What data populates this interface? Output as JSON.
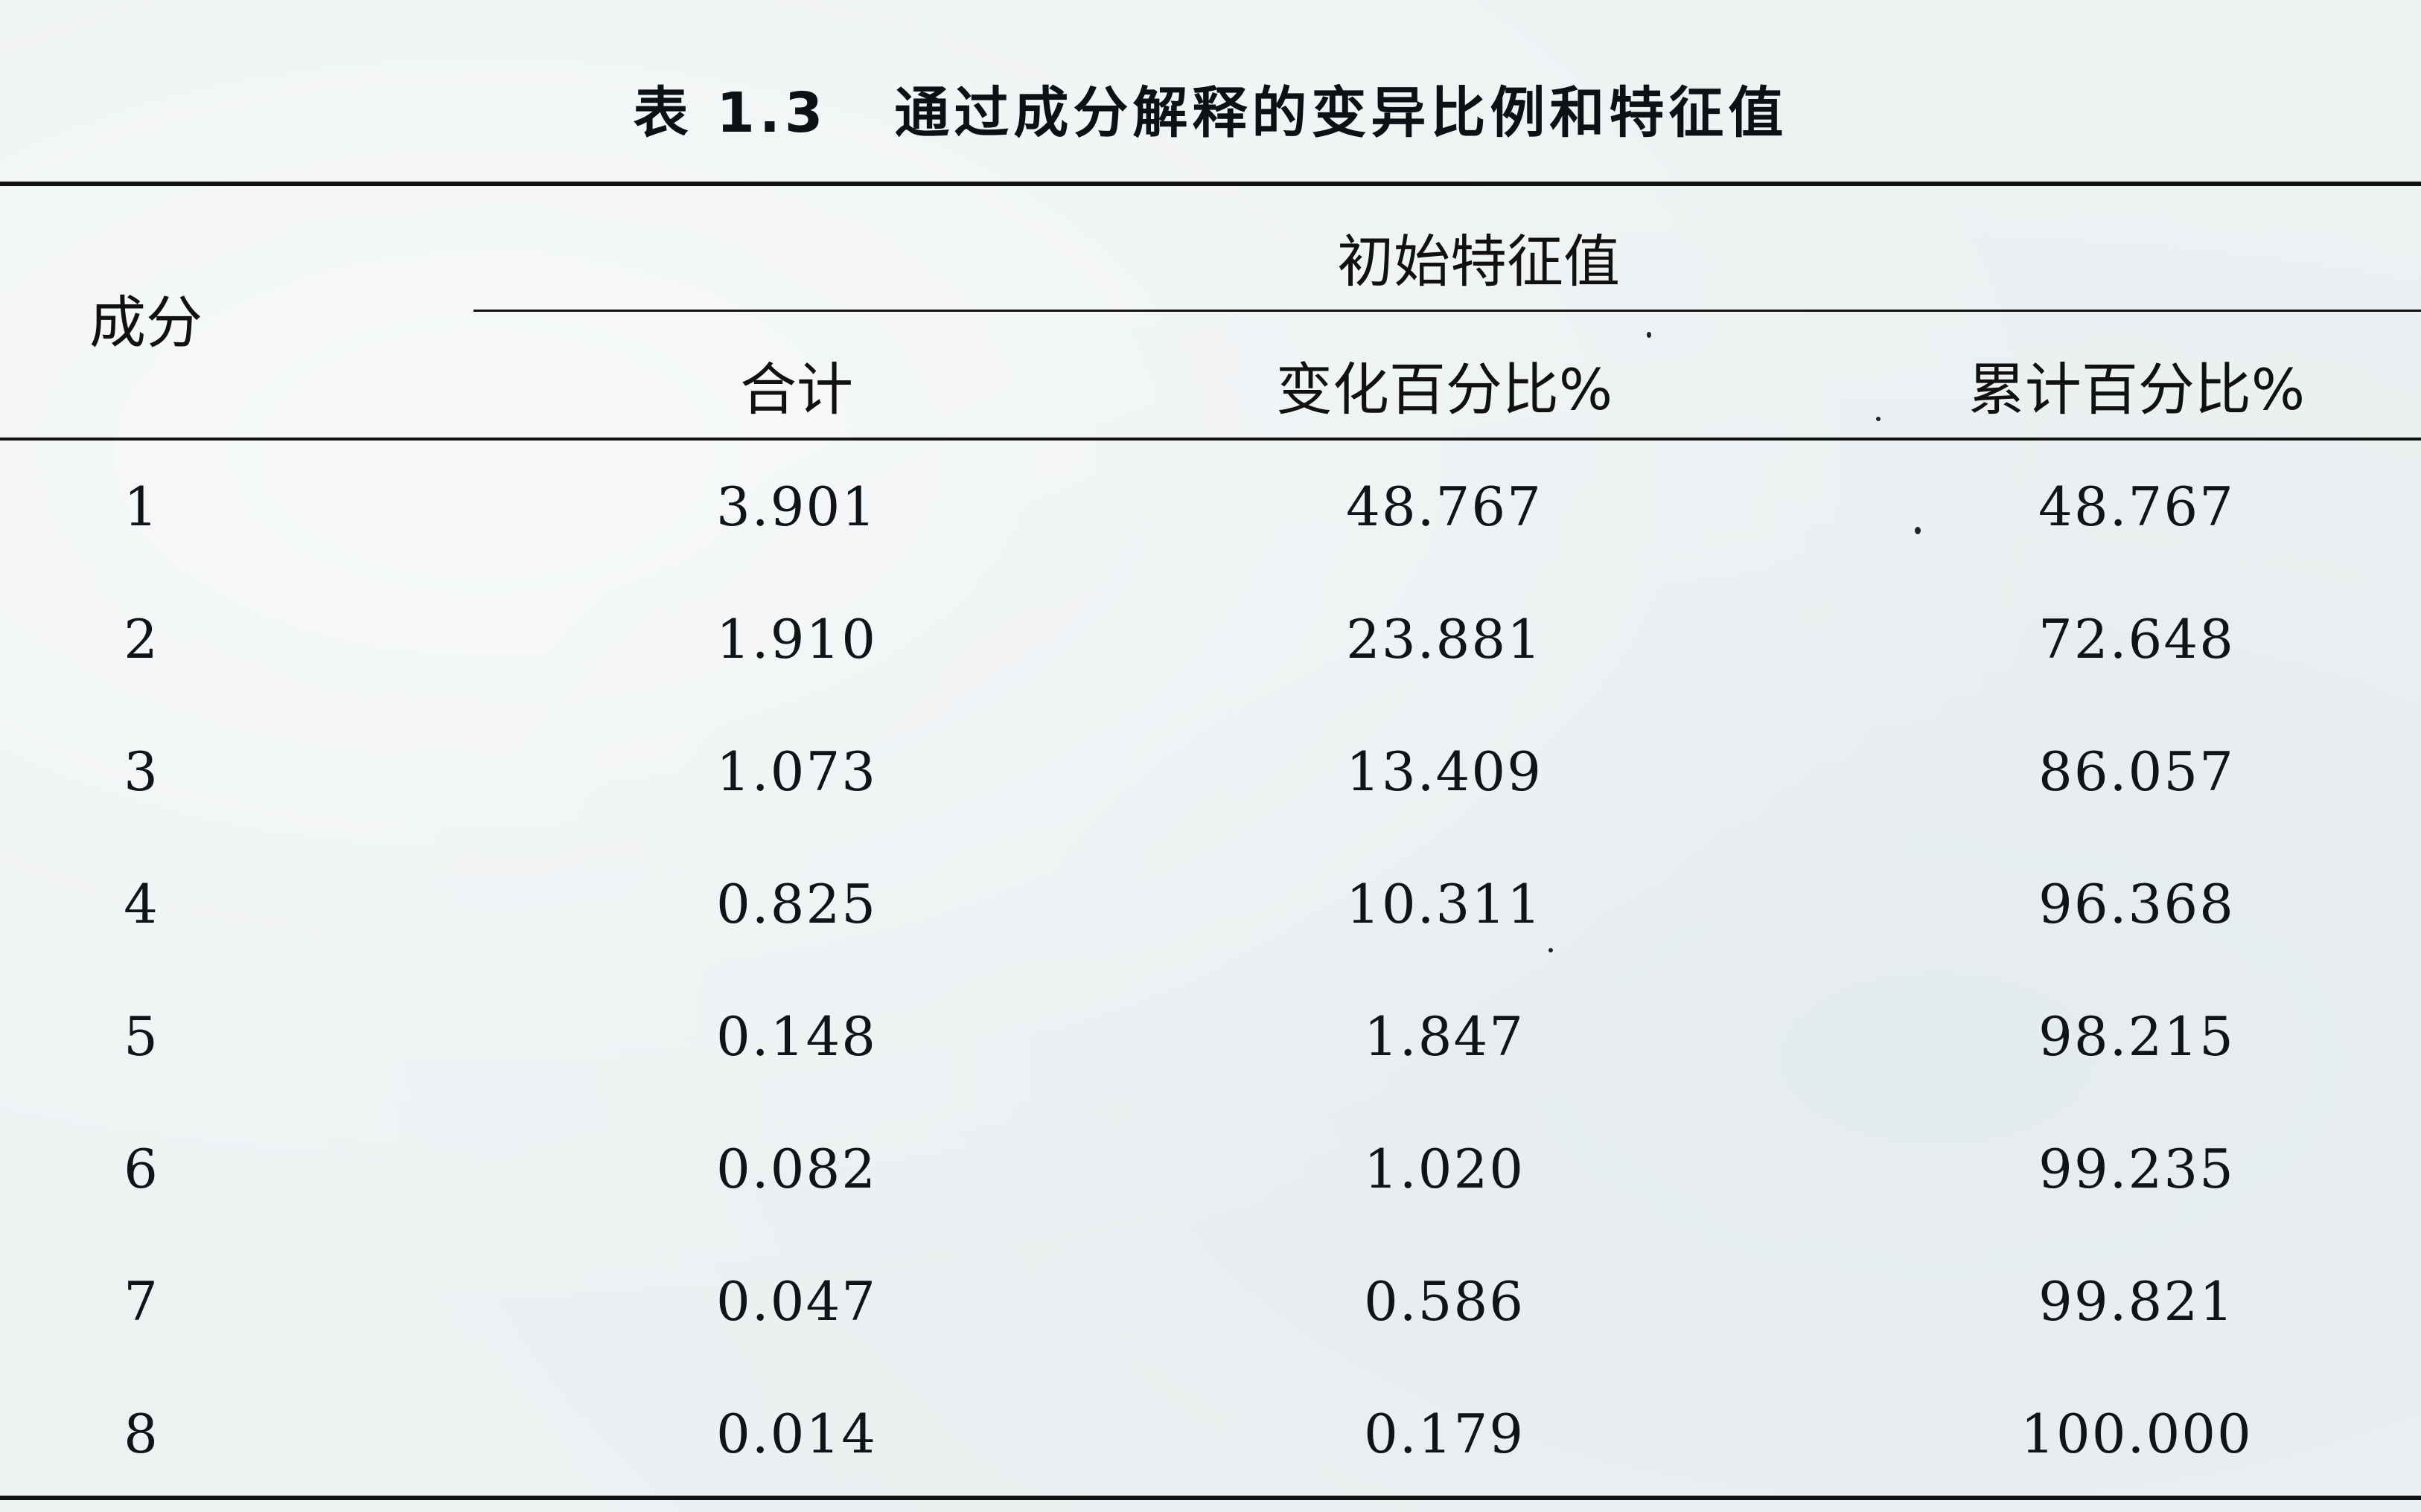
{
  "caption": {
    "number": "表 1.3",
    "title": "通过成分解释的变异比例和特征值"
  },
  "header": {
    "component": "成分",
    "group": "初始特征值",
    "columns": [
      "合计",
      "变化百分比%",
      "累计百分比%"
    ]
  },
  "rows": [
    {
      "component": "1",
      "total": "3.901",
      "pct_variance": "48.767",
      "cumulative_pct": "48.767"
    },
    {
      "component": "2",
      "total": "1.910",
      "pct_variance": "23.881",
      "cumulative_pct": "72.648"
    },
    {
      "component": "3",
      "total": "1.073",
      "pct_variance": "13.409",
      "cumulative_pct": "86.057"
    },
    {
      "component": "4",
      "total": "0.825",
      "pct_variance": "10.311",
      "cumulative_pct": "96.368"
    },
    {
      "component": "5",
      "total": "0.148",
      "pct_variance": "1.847",
      "cumulative_pct": "98.215"
    },
    {
      "component": "6",
      "total": "0.082",
      "pct_variance": "1.020",
      "cumulative_pct": "99.235"
    },
    {
      "component": "7",
      "total": "0.047",
      "pct_variance": "0.586",
      "cumulative_pct": "99.821"
    },
    {
      "component": "8",
      "total": "0.014",
      "pct_variance": "0.179",
      "cumulative_pct": "100.000"
    }
  ],
  "colors": {
    "paper": "#edf1f2",
    "ink": "#101418"
  }
}
